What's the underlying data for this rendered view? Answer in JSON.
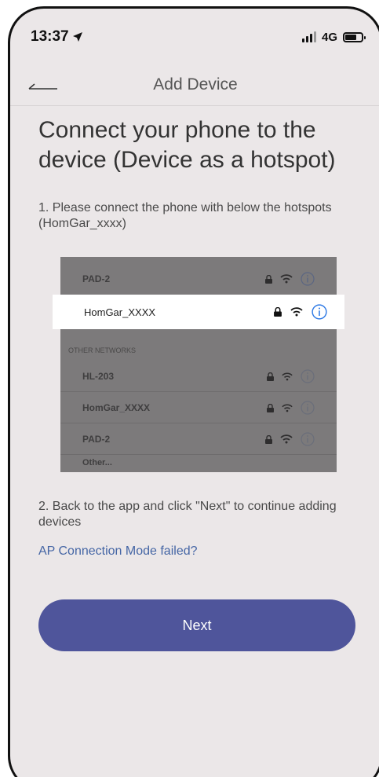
{
  "status": {
    "time": "13:37",
    "network": "4G"
  },
  "nav": {
    "title": "Add Device"
  },
  "heading": "Connect your phone to the device (Device as a hotspot)",
  "step1": "1. Please connect the phone with below the hotspots (HomGar_xxxx)",
  "wifi_list": {
    "top_network": "PAD-2",
    "highlighted_network": "HomGar_XXXX",
    "section_label": "OTHER NETWORKS",
    "networks": [
      "HL-203",
      "HomGar_XXXX",
      "PAD-2",
      "Other..."
    ]
  },
  "step2": "2. Back to the app and click \"Next\" to continue adding devices",
  "link": "AP Connection Mode failed?",
  "next_button": "Next",
  "colors": {
    "accent": "#4f559b",
    "link": "#4566a5",
    "background": "#ebe7e8"
  }
}
